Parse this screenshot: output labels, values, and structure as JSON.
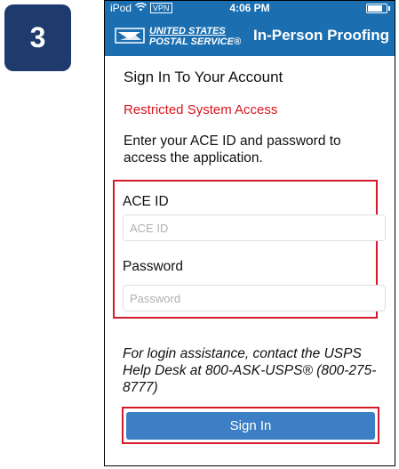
{
  "step": {
    "number": "3"
  },
  "status_bar": {
    "device": "iPod",
    "vpn": "VPN",
    "time": "4:06 PM",
    "wifi_icon": "wifi-icon",
    "battery_icon": "battery-icon",
    "battery_level": 0.9
  },
  "header": {
    "logo_line1": "UNITED STATES",
    "logo_line2": "POSTAL SERVICE",
    "logo_mark": "®",
    "logo_icon": "eagle-icon",
    "title": "In-Person Proofing"
  },
  "form": {
    "title": "Sign In To Your Account",
    "restricted": "Restricted System Access",
    "instructions": "Enter your ACE ID and password to access the application.",
    "ace_id_label": "ACE ID",
    "ace_id_placeholder": "ACE ID",
    "ace_id_value": "",
    "password_label": "Password",
    "password_placeholder": "Password",
    "password_value": "",
    "help": "For login assistance, contact the USPS Help Desk at 800-ASK-USPS® (800-275-8777)",
    "sign_in_label": "Sign In"
  },
  "colors": {
    "header_blue": "#1b6fb1",
    "badge_navy": "#1f3a6d",
    "highlight_red": "#d6192b",
    "restricted_red": "#d9141e",
    "button_blue": "#3d7fc4"
  }
}
